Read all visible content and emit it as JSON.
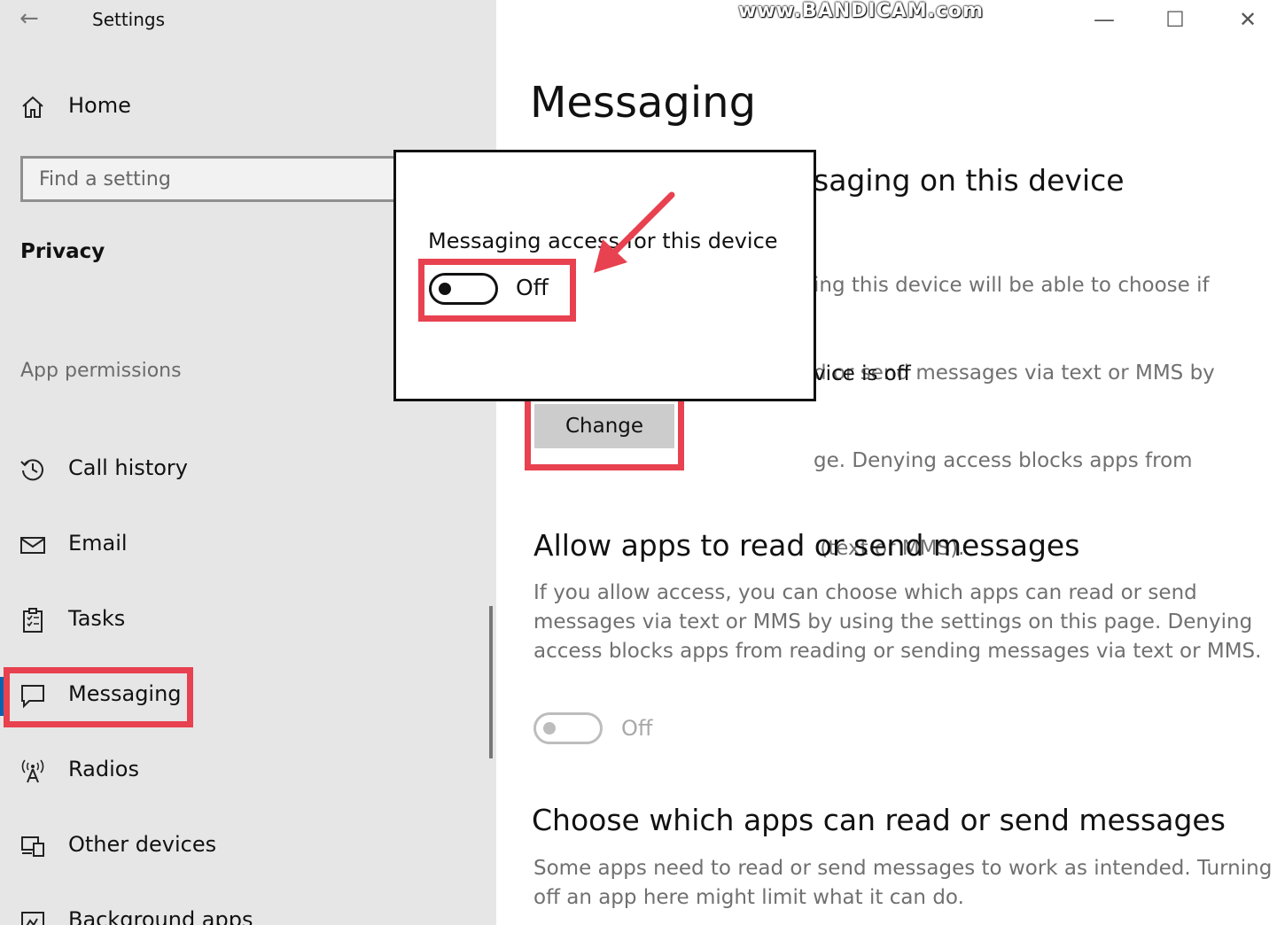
{
  "window": {
    "app_title": "Settings",
    "watermark": "www.BANDICAM.com",
    "minimize_glyph": "—",
    "maximize_glyph": "☐",
    "close_glyph": "✕",
    "back_glyph": "←"
  },
  "sidebar": {
    "home_label": "Home",
    "search_placeholder": "Find a setting",
    "section": "Privacy",
    "permissions_header": "App permissions",
    "items": [
      {
        "label": "Call history",
        "icon": "call-history-icon"
      },
      {
        "label": "Email",
        "icon": "email-icon"
      },
      {
        "label": "Tasks",
        "icon": "tasks-icon"
      },
      {
        "label": "Messaging",
        "icon": "messaging-icon",
        "selected": true
      },
      {
        "label": "Radios",
        "icon": "radios-icon"
      },
      {
        "label": "Other devices",
        "icon": "other-devices-icon"
      },
      {
        "label": "Background apps",
        "icon": "background-apps-icon"
      }
    ]
  },
  "main": {
    "page_title": "Messaging",
    "device_section": {
      "title_fragment": "saging on this device",
      "desc_lines": [
        "ing this device will be able to choose if",
        "d or send messages via text or MMS by",
        "ge. Denying access blocks apps from",
        " (text or MMS)."
      ],
      "status_fragment": "vice is off",
      "change_label": "Change"
    },
    "allow_section": {
      "title": "Allow apps to read or send messages",
      "desc_lines": [
        "If you allow access, you can choose which apps can read or send",
        "messages via text or MMS by using the settings on this page. Denying",
        "access blocks apps from reading or sending messages via text or MMS."
      ],
      "toggle_state": "Off"
    },
    "choose_section": {
      "title": "Choose which apps can read or send messages",
      "desc_lines": [
        "Some apps need to read or send messages to work as intended. Turning",
        "off an app here might limit what it can do."
      ]
    }
  },
  "popup": {
    "label": "Messaging access for this device",
    "toggle_state": "Off",
    "toggle_on": false
  },
  "colors": {
    "highlight": "#e8414f",
    "sidebar_bg": "#e6e6e6"
  }
}
